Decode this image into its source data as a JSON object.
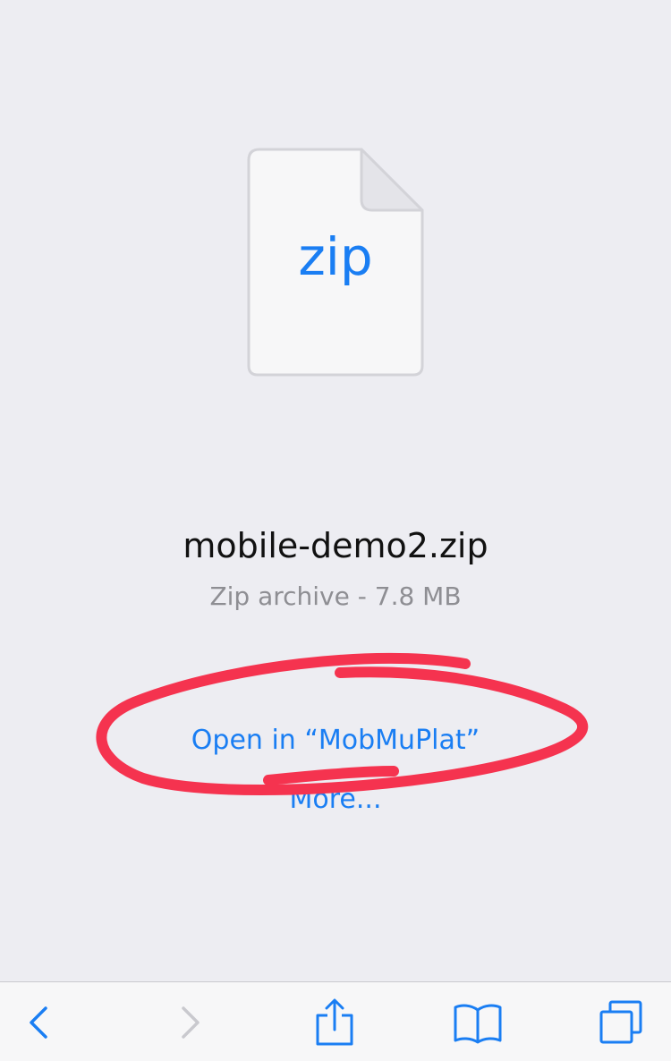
{
  "file": {
    "icon_label": "zip",
    "name": "mobile-demo2.zip",
    "meta": "Zip archive - 7.8 MB"
  },
  "actions": {
    "open_in": "Open in “MobMuPlat”",
    "more": "More..."
  },
  "toolbar": {
    "icons": [
      "back-icon",
      "forward-icon",
      "share-icon",
      "bookmarks-icon",
      "tabs-icon"
    ]
  },
  "colors": {
    "accent": "#1a7ef3",
    "annotation": "#f5334f",
    "background": "#ededf2",
    "toolbar": "#f7f7f8",
    "secondary_text": "#8e8e93"
  }
}
